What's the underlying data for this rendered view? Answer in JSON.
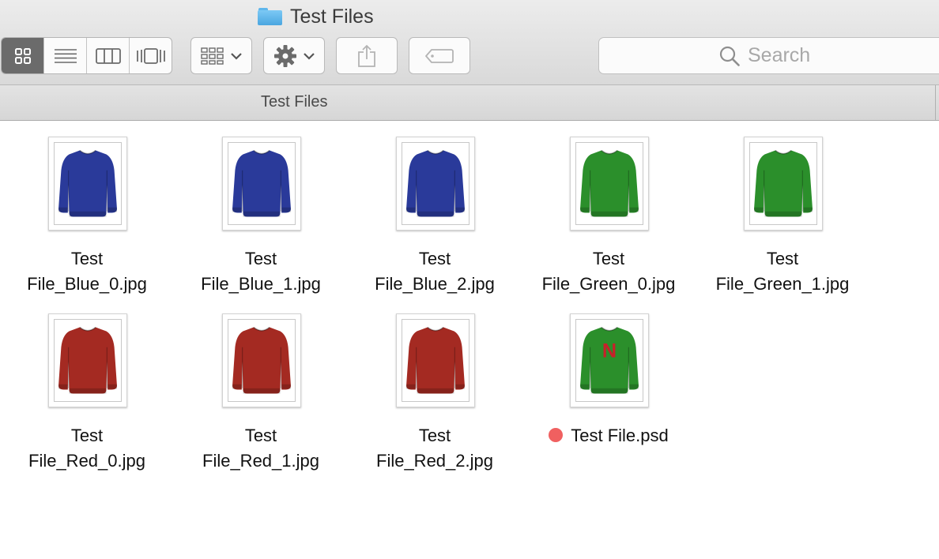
{
  "window": {
    "title": "Test Files"
  },
  "toolbar": {
    "views": [
      {
        "name": "icon-view",
        "active": true
      },
      {
        "name": "list-view",
        "active": false
      },
      {
        "name": "column-view",
        "active": false
      },
      {
        "name": "cover-flow-view",
        "active": false
      }
    ],
    "group_icon": "arrange-grid-icon",
    "action_icon": "gear-icon",
    "share_icon": "share-icon",
    "tag_icon": "tag-icon"
  },
  "search": {
    "placeholder": "Search"
  },
  "pathbar": {
    "label": "Test Files"
  },
  "files": [
    {
      "line1": "Test",
      "line2": "File_Blue_0.jpg",
      "color": "#2a3a9a",
      "tag": null
    },
    {
      "line1": "Test",
      "line2": "File_Blue_1.jpg",
      "color": "#2a3a9a",
      "tag": null
    },
    {
      "line1": "Test",
      "line2": "File_Blue_2.jpg",
      "color": "#2a3a9a",
      "tag": null
    },
    {
      "line1": "Test",
      "line2": "File_Green_0.jpg",
      "color": "#2b8f2b",
      "tag": null
    },
    {
      "line1": "Test",
      "line2": "File_Green_1.jpg",
      "color": "#2b8f2b",
      "tag": null
    },
    {
      "line1": "Test",
      "line2": "File_Red_0.jpg",
      "color": "#a42a22",
      "tag": null
    },
    {
      "line1": "Test",
      "line2": "File_Red_1.jpg",
      "color": "#a42a22",
      "tag": null
    },
    {
      "line1": "Test",
      "line2": "File_Red_2.jpg",
      "color": "#a42a22",
      "tag": null
    },
    {
      "line1": "Test File.psd",
      "line2": "",
      "color": "#2b8f2b",
      "tag": "#f06060",
      "print": "N",
      "print_color": "#c8202a"
    }
  ]
}
